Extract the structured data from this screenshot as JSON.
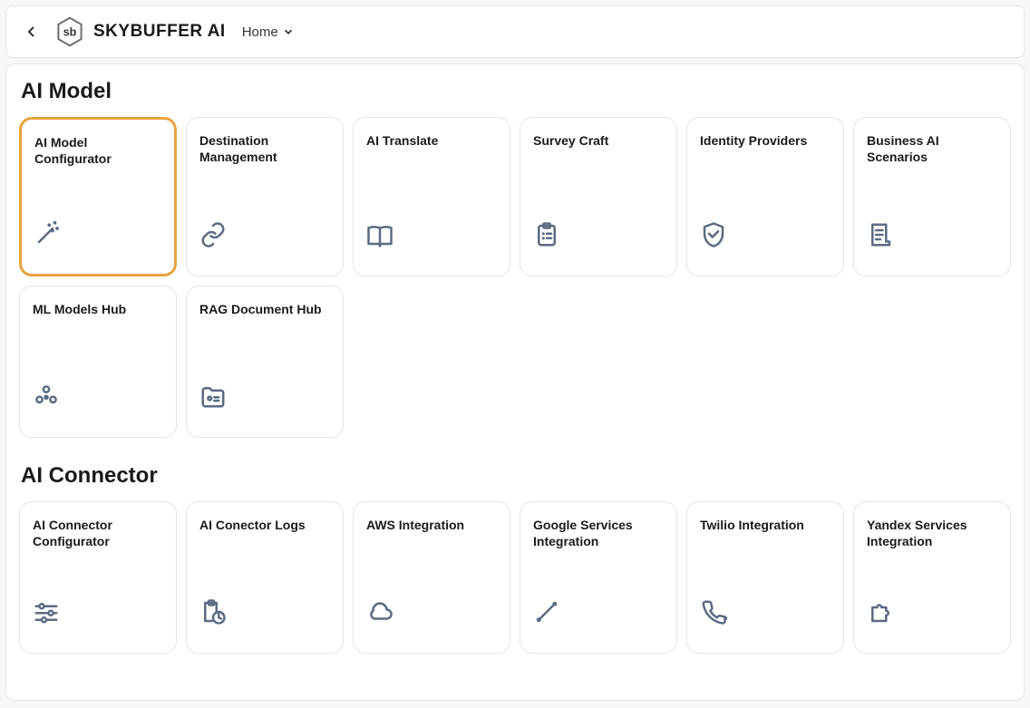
{
  "header": {
    "brand": "SKYBUFFER AI",
    "nav_home": "Home"
  },
  "sections": {
    "ai_model": {
      "title": "AI Model",
      "cards": [
        {
          "title": "AI Model Configurator",
          "icon": "wand"
        },
        {
          "title": "Destination Management",
          "icon": "link"
        },
        {
          "title": "AI Translate",
          "icon": "book"
        },
        {
          "title": "Survey Craft",
          "icon": "clipboard"
        },
        {
          "title": "Identity Providers",
          "icon": "shield"
        },
        {
          "title": "Business AI Scenarios",
          "icon": "doc-lines"
        },
        {
          "title": "ML Models Hub",
          "icon": "circles"
        },
        {
          "title": "RAG Document Hub",
          "icon": "folder-id"
        }
      ]
    },
    "ai_connector": {
      "title": "AI Connector",
      "cards": [
        {
          "title": "AI Connector Configurator",
          "icon": "sliders"
        },
        {
          "title": "AI Conector Logs",
          "icon": "clipboard-clock"
        },
        {
          "title": "AWS Integration",
          "icon": "cloud"
        },
        {
          "title": "Google Services Integration",
          "icon": "diagonal"
        },
        {
          "title": "Twilio Integration",
          "icon": "phone"
        },
        {
          "title": "Yandex Services Integration",
          "icon": "puzzle"
        }
      ]
    }
  }
}
